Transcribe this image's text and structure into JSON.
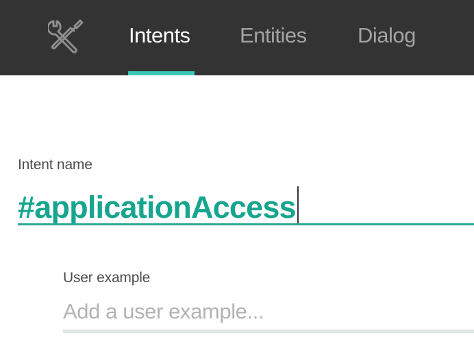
{
  "nav": {
    "icon": "tools-icon",
    "tabs": [
      {
        "label": "Intents",
        "active": true
      },
      {
        "label": "Entities",
        "active": false
      },
      {
        "label": "Dialog",
        "active": false
      }
    ],
    "accent_color": "#3bc9b5"
  },
  "intent": {
    "label": "Intent name",
    "value": "#applicationAccess",
    "value_color": "#18a58f"
  },
  "user_example": {
    "label": "User example",
    "placeholder": "Add a user example...",
    "value": ""
  }
}
